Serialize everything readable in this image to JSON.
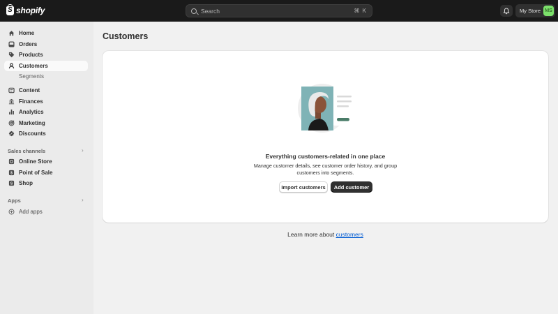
{
  "topbar": {
    "logo_text": "shopify",
    "search_placeholder": "Search",
    "search_shortcut": "⌘ K",
    "store_name": "My Store",
    "avatar_initials": "MS"
  },
  "sidebar": {
    "items": [
      {
        "label": "Home",
        "icon": "home-icon"
      },
      {
        "label": "Orders",
        "icon": "orders-icon"
      },
      {
        "label": "Products",
        "icon": "tag-icon"
      },
      {
        "label": "Customers",
        "icon": "person-icon"
      },
      {
        "label": "Content",
        "icon": "content-icon"
      },
      {
        "label": "Finances",
        "icon": "bank-icon"
      },
      {
        "label": "Analytics",
        "icon": "bar-chart-icon"
      },
      {
        "label": "Marketing",
        "icon": "target-icon"
      },
      {
        "label": "Discounts",
        "icon": "discount-icon"
      }
    ],
    "customers_sub": "Segments",
    "sales_channels_label": "Sales channels",
    "sales_channels": [
      {
        "label": "Online Store",
        "icon": "store-icon"
      },
      {
        "label": "Point of Sale",
        "icon": "pos-icon"
      },
      {
        "label": "Shop",
        "icon": "shop-icon"
      }
    ],
    "apps_label": "Apps",
    "add_apps": "Add apps"
  },
  "main": {
    "page_title": "Customers",
    "empty_title": "Everything customers-related in one place",
    "empty_desc": "Manage customer details, see customer order history, and group customers into segments.",
    "import_button": "Import customers",
    "add_button": "Add customer",
    "learn_prefix": "Learn more about ",
    "learn_link": "customers"
  },
  "colors": {
    "topbar": "#1a1a1a",
    "sidebar": "#ebebeb",
    "background": "#f1f1f1",
    "primary_button": "#303030",
    "link": "#005bd3",
    "avatar": "#7ce16b",
    "illustration_accent": "#4a7c68"
  }
}
